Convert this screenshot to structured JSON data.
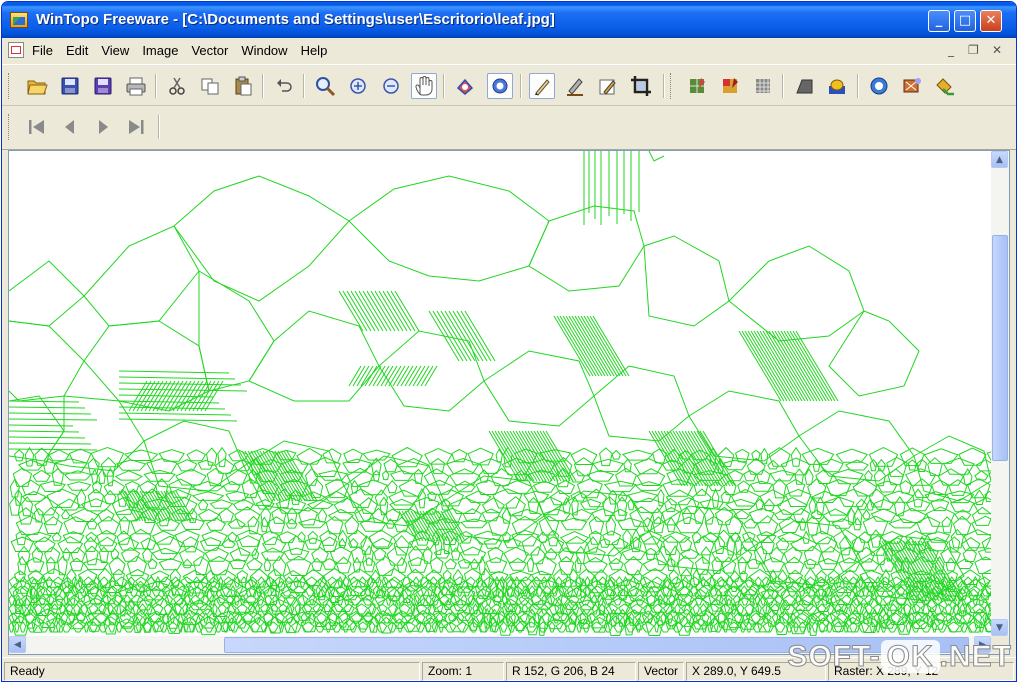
{
  "window": {
    "title": "WinTopo Freeware - [C:\\Documents and Settings\\user\\Escritorio\\leaf.jpg]",
    "minimize": "_",
    "maximize": "□",
    "close": "✕"
  },
  "menu": {
    "items": [
      "File",
      "Edit",
      "View",
      "Image",
      "Vector",
      "Window",
      "Help"
    ],
    "mdi_minimize": "_",
    "mdi_restore": "❐",
    "mdi_close": "✕"
  },
  "toolbar": {
    "tools": [
      {
        "name": "open",
        "icon": "open-folder-icon"
      },
      {
        "name": "save",
        "icon": "save-icon"
      },
      {
        "name": "save-as",
        "icon": "save-as-icon"
      },
      {
        "name": "print",
        "icon": "print-icon"
      },
      {
        "name": "cut",
        "icon": "scissors-icon"
      },
      {
        "name": "copy",
        "icon": "copy-icon"
      },
      {
        "name": "paste",
        "icon": "paste-icon"
      },
      {
        "name": "undo",
        "icon": "undo-icon"
      },
      {
        "name": "zoom",
        "icon": "magnifier-icon"
      },
      {
        "name": "zoom-in",
        "icon": "zoom-in-icon"
      },
      {
        "name": "zoom-out",
        "icon": "zoom-out-icon"
      },
      {
        "name": "pan",
        "icon": "hand-icon"
      },
      {
        "name": "show-raster",
        "icon": "raster-view-icon"
      },
      {
        "name": "show-vector",
        "icon": "vector-view-icon"
      },
      {
        "name": "draw-line",
        "icon": "pen-icon"
      },
      {
        "name": "edit-pen",
        "icon": "edit-pen-icon"
      },
      {
        "name": "edit-area",
        "icon": "area-edit-icon"
      },
      {
        "name": "crop",
        "icon": "crop-icon"
      },
      {
        "name": "raster-tool-1",
        "icon": "raster-process-icon"
      },
      {
        "name": "raster-tool-2",
        "icon": "raster-process-color-icon"
      },
      {
        "name": "raster-tool-3",
        "icon": "raster-process-grid-icon"
      },
      {
        "name": "thin",
        "icon": "thin-icon"
      },
      {
        "name": "vectorize",
        "icon": "vectorize-icon"
      },
      {
        "name": "vector-tool-1",
        "icon": "vector-options-icon"
      },
      {
        "name": "vector-tool-2",
        "icon": "vector-wizard-icon"
      },
      {
        "name": "vector-tool-3",
        "icon": "vector-export-icon"
      }
    ],
    "nav": [
      {
        "name": "first",
        "icon": "first-page-icon"
      },
      {
        "name": "prev",
        "icon": "prev-page-icon"
      },
      {
        "name": "next",
        "icon": "next-page-icon"
      },
      {
        "name": "last",
        "icon": "last-page-icon"
      }
    ]
  },
  "canvas": {
    "line_color": "#22d622",
    "background": "#ffffff"
  },
  "status": {
    "ready": "Ready",
    "zoom": "Zoom: 1",
    "rgb": "R 152, G 206, B 24",
    "mode": "Vector",
    "coords": "X 289.0, Y 649.5",
    "raster": "Raster: X 289, Y 12"
  },
  "watermark": {
    "left": "SOFT-",
    "middle": "OK",
    "right": ".NET"
  },
  "colors": {
    "titlebar": "#0a5ee8",
    "chrome": "#ece9d8",
    "vector_green": "#22d622"
  }
}
